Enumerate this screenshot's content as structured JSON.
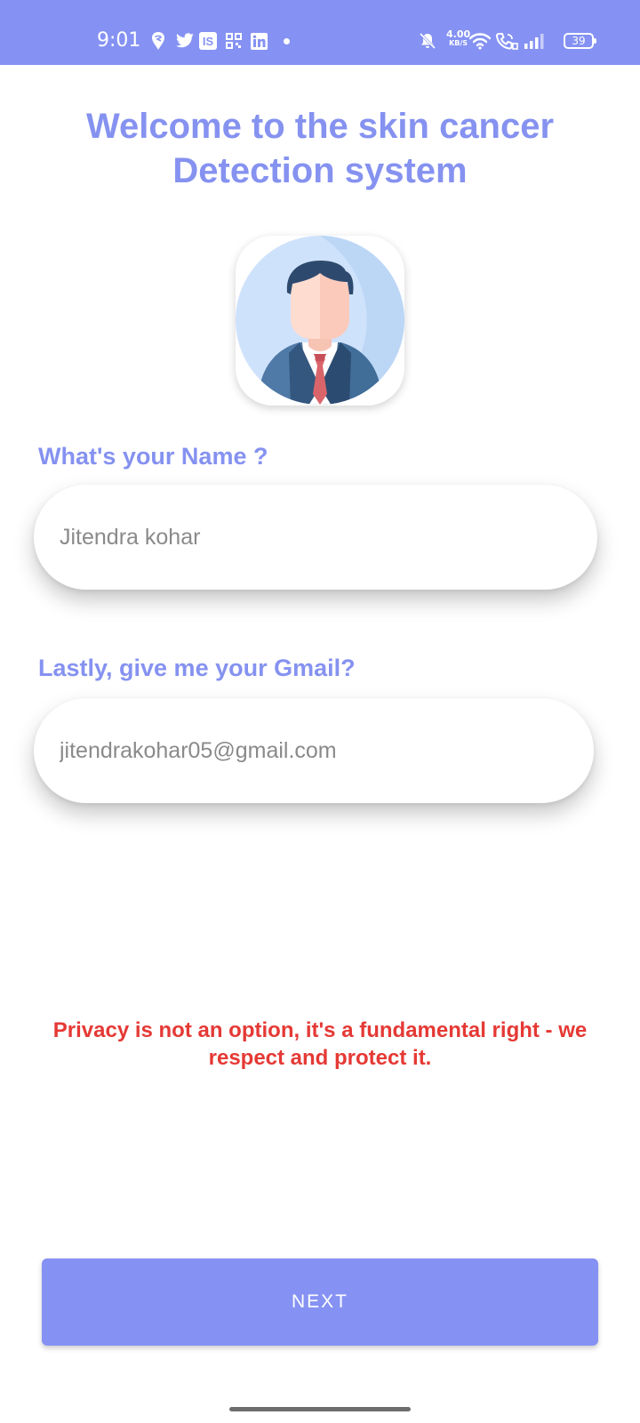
{
  "status_bar": {
    "time": "9:01",
    "network_speed": "4.00",
    "network_speed_unit": "KB/S",
    "battery": "39",
    "background_color": "#8592f3",
    "icons": [
      "swiggy-icon",
      "twitter-icon",
      "is-app-icon",
      "qr-app-icon",
      "linkedin-icon",
      "notification-dot-icon",
      "mute-icon",
      "wifi-icon",
      "wifi-calling-icon",
      "signal-icon",
      "battery-icon"
    ]
  },
  "header": {
    "title": "Welcome to the skin cancer Detection system",
    "color": "#8592f0"
  },
  "avatar": {
    "icon": "businessman-avatar-icon"
  },
  "form": {
    "name_label": "What's your Name ?",
    "name_value": "Jitendra kohar",
    "email_label": "Lastly, give me your Gmail?",
    "email_value": "jitendrakohar05@gmail.com"
  },
  "privacy_notice": {
    "text": "Privacy is not an option, it's a fundamental right - we respect and protect it.",
    "color": "#e53935"
  },
  "actions": {
    "next_label": "NEXT",
    "button_color": "#8592f3"
  }
}
